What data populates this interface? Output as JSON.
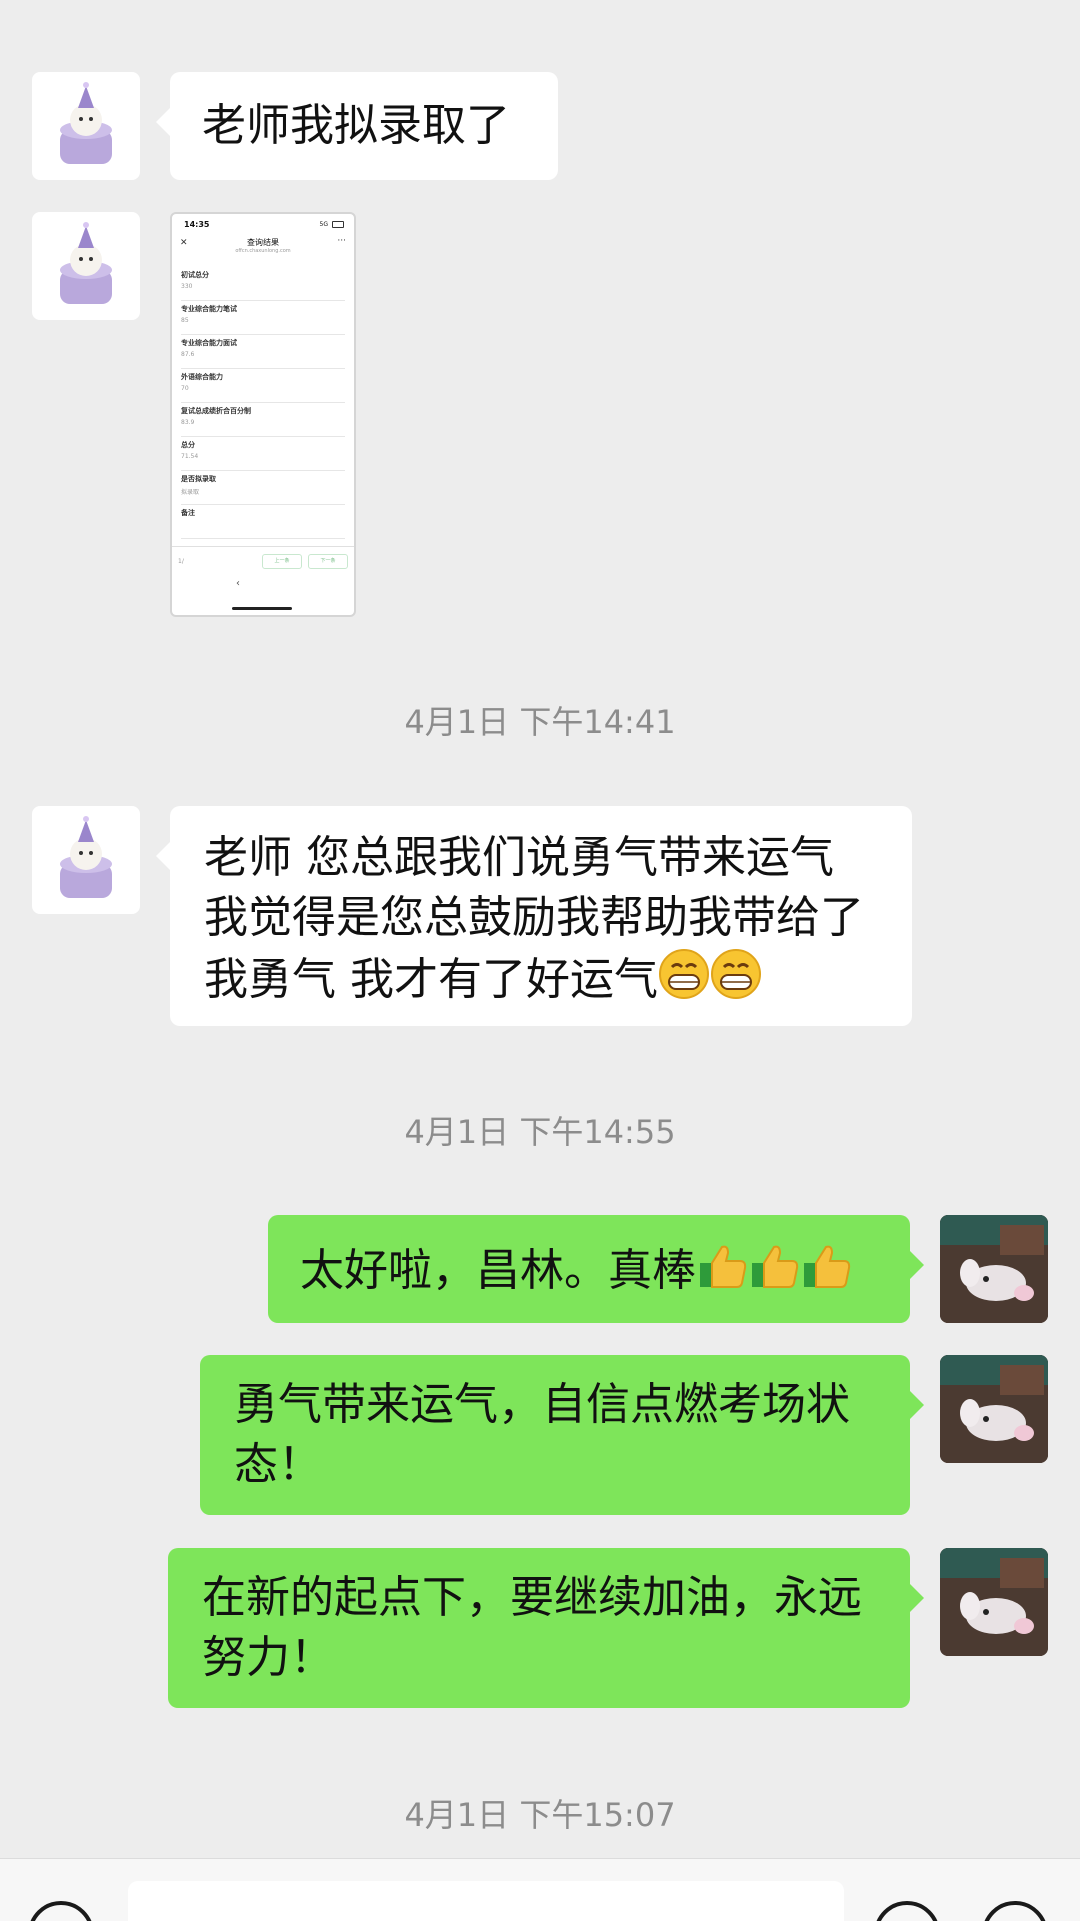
{
  "messages": {
    "m1_text": "老师我拟录取了",
    "m3_line1": "老师 您总跟我们说勇气带来运气",
    "m3_line2": "我觉得是您总鼓励我帮助我带给了",
    "m3_line3": "我勇气 我才有了好运气",
    "m4_text": "太好啦，昌林。真棒",
    "m5_line1": "勇气带来运气，自信点燃考场状",
    "m5_line2": "态！",
    "m6_line1": "在新的起点下，要继续加油，永远",
    "m6_line2": "努力！"
  },
  "timestamps": {
    "t1": "4月1日 下午14:41",
    "t2": "4月1日 下午14:55",
    "t3": "4月1日 下午15:07"
  },
  "screenshot": {
    "status_time": "14:35",
    "status_signal": "5G",
    "title": "查询结果",
    "url": "offcn.chaxunlong.com",
    "rows": [
      {
        "label": "初试总分",
        "value": "330"
      },
      {
        "label": "专业综合能力笔试",
        "value": "85"
      },
      {
        "label": "专业综合能力面试",
        "value": "87.6"
      },
      {
        "label": "外语综合能力",
        "value": "70"
      },
      {
        "label": "复试总成绩折合百分制",
        "value": "83.9"
      },
      {
        "label": "总分",
        "value": "71.54"
      },
      {
        "label": "是否拟录取",
        "value": "拟录取"
      },
      {
        "label": "备注",
        "value": ""
      }
    ],
    "page": "1/",
    "prev_label": "上一条",
    "next_label": "下一条"
  }
}
